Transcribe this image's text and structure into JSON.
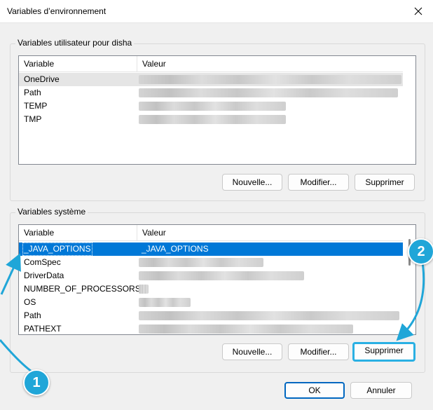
{
  "window": {
    "title": "Variables d’environnement"
  },
  "user_group": {
    "label": "Variables utilisateur pour disha",
    "columns": [
      "Variable",
      "Valeur"
    ],
    "rows": [
      {
        "name": "OneDrive",
        "value": ""
      },
      {
        "name": "Path",
        "value": ""
      },
      {
        "name": "TEMP",
        "value": ""
      },
      {
        "name": "TMP",
        "value": ""
      }
    ],
    "buttons": {
      "new": "Nouvelle...",
      "edit": "Modifier...",
      "delete": "Supprimer"
    }
  },
  "system_group": {
    "label": "Variables système",
    "columns": [
      "Variable",
      "Valeur"
    ],
    "rows": [
      {
        "name": "_JAVA_OPTIONS",
        "value": "_JAVA_OPTIONS"
      },
      {
        "name": "ComSpec",
        "value": ""
      },
      {
        "name": "DriverData",
        "value": ""
      },
      {
        "name": "NUMBER_OF_PROCESSORS",
        "value": ""
      },
      {
        "name": "OS",
        "value": ""
      },
      {
        "name": "Path",
        "value": ""
      },
      {
        "name": "PATHEXT",
        "value": ""
      }
    ],
    "buttons": {
      "new": "Nouvelle...",
      "edit": "Modifier...",
      "delete": "Supprimer"
    }
  },
  "footer": {
    "ok": "OK",
    "cancel": "Annuler"
  },
  "callouts": [
    "1",
    "2"
  ],
  "colors": {
    "selection": "#0078d7",
    "callout": "#20a6d8",
    "primary_border": "#0067c0"
  }
}
